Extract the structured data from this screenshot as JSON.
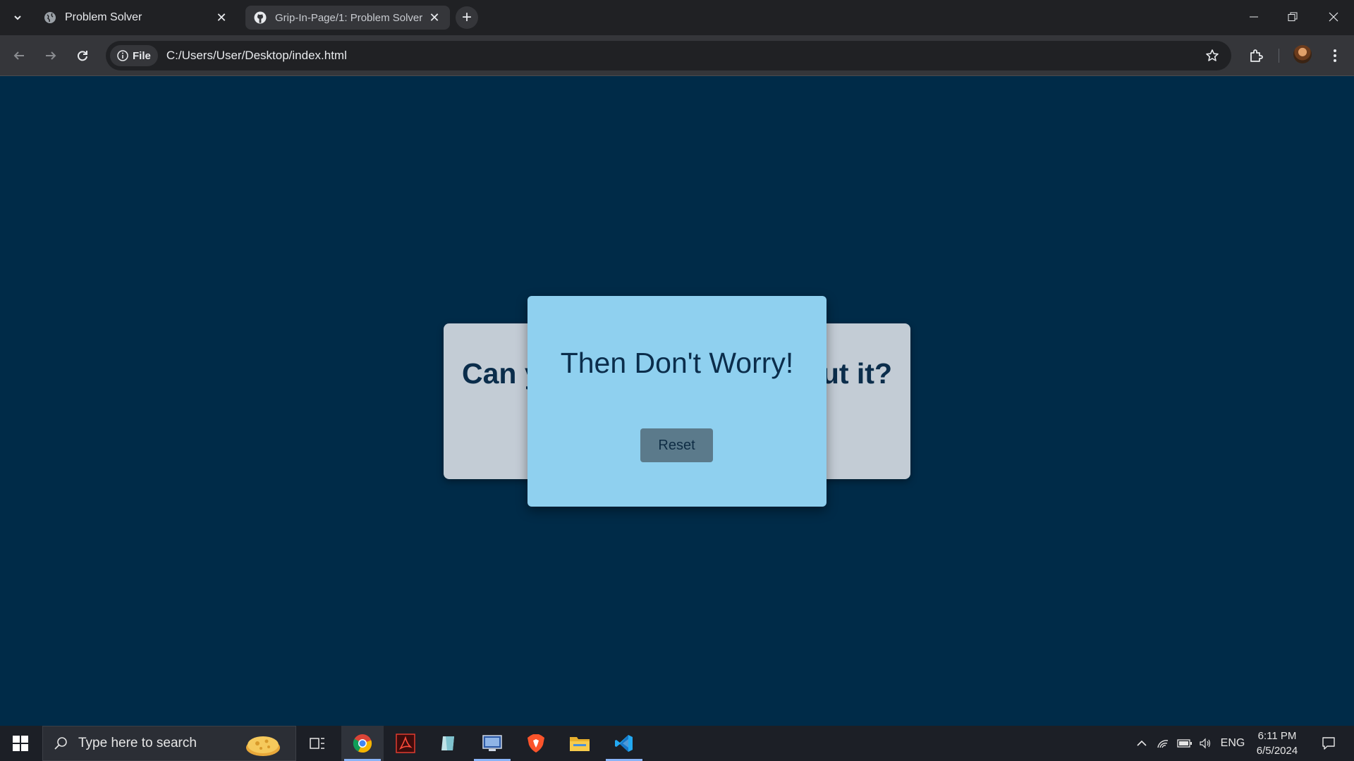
{
  "browser": {
    "tabs": [
      {
        "title": "Problem Solver",
        "icon": "globe-icon",
        "active": false
      },
      {
        "title": "Grip-In-Page/1: Problem Solver",
        "icon": "github-icon",
        "active": true
      }
    ],
    "omnibox": {
      "site_chip_label": "File",
      "url": "C:/Users/User/Desktop/index.html"
    }
  },
  "page": {
    "back_card": {
      "question_left": "Can y",
      "question_right": "ut it?"
    },
    "front_card": {
      "heading": "Then Don't Worry!",
      "button_label": "Reset"
    },
    "colors": {
      "background": "#002b48",
      "back_card": "#c3ccd5",
      "front_card": "#8fd0ef",
      "button": "#5b7a8b",
      "text": "#0b2d4b"
    }
  },
  "taskbar": {
    "search_placeholder": "Type here to search",
    "apps": [
      "task-view-icon",
      "chrome-icon",
      "acrobat-icon",
      "notepad-icon",
      "remote-desktop-icon",
      "brave-icon",
      "file-explorer-icon",
      "vscode-icon"
    ],
    "language": "ENG",
    "time": "6:11 PM",
    "date": "6/5/2024"
  }
}
